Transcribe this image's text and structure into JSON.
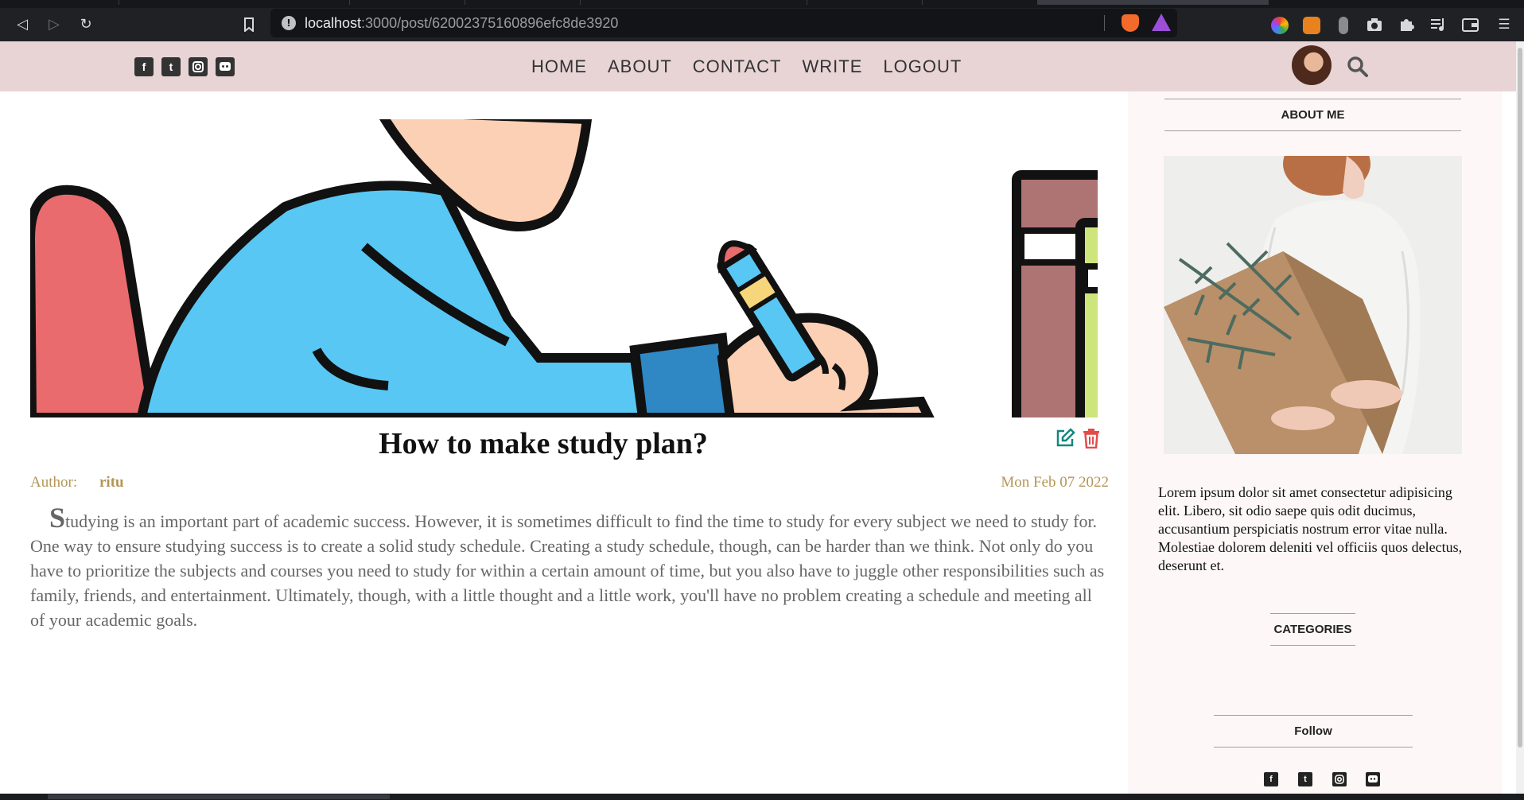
{
  "browser": {
    "url_host": "localhost",
    "url_path": ":3000/post/62002375160896efc8de3920",
    "back_icon": "back-arrow-icon",
    "forward_icon": "forward-arrow-icon",
    "reload_icon": "reload-icon",
    "bookmark_icon": "bookmark-icon",
    "site_info_icon": "site-info-icon"
  },
  "header": {
    "social_icons": [
      "facebook-icon",
      "twitter-icon",
      "instagram-icon",
      "discord-icon"
    ],
    "menu": [
      "HOME",
      "ABOUT",
      "CONTACT",
      "WRITE",
      "LOGOUT"
    ],
    "background_color": "#e8d4d5"
  },
  "post": {
    "title": "How to make study plan?",
    "author_label": "Author:",
    "author": "ritu",
    "date": "Mon Feb 07 2022",
    "body": "Studying is an important part of academic success. However, it is sometimes difficult to find the time to study for every subject we need to study for. One way to ensure studying success is to create a solid study schedule. Creating a study schedule, though, can be harder than we think. Not only do you have to prioritize the subjects and courses you need to study for within a certain amount of time, but you also have to juggle other responsibilities such as family, friends, and entertainment. Ultimately, though, with a little thought and a little work, you'll have no problem creating a schedule and meeting all of your academic goals.",
    "edit_color": "#138780",
    "delete_color": "#e34b4b",
    "meta_color": "#b39656"
  },
  "sidebar": {
    "about_title": "ABOUT ME",
    "about_text": "Lorem ipsum dolor sit amet consectetur adipisicing elit. Libero, sit odio saepe quis odit ducimus, accusantium perspiciatis nostrum error vitae nulla. Molestiae dolorem deleniti vel officiis quos delectus, deserunt et.",
    "categories_title": "CATEGORIES",
    "follow_title": "Follow",
    "follow_icons": [
      "facebook-icon",
      "twitter-icon",
      "instagram-icon",
      "discord-icon"
    ]
  }
}
